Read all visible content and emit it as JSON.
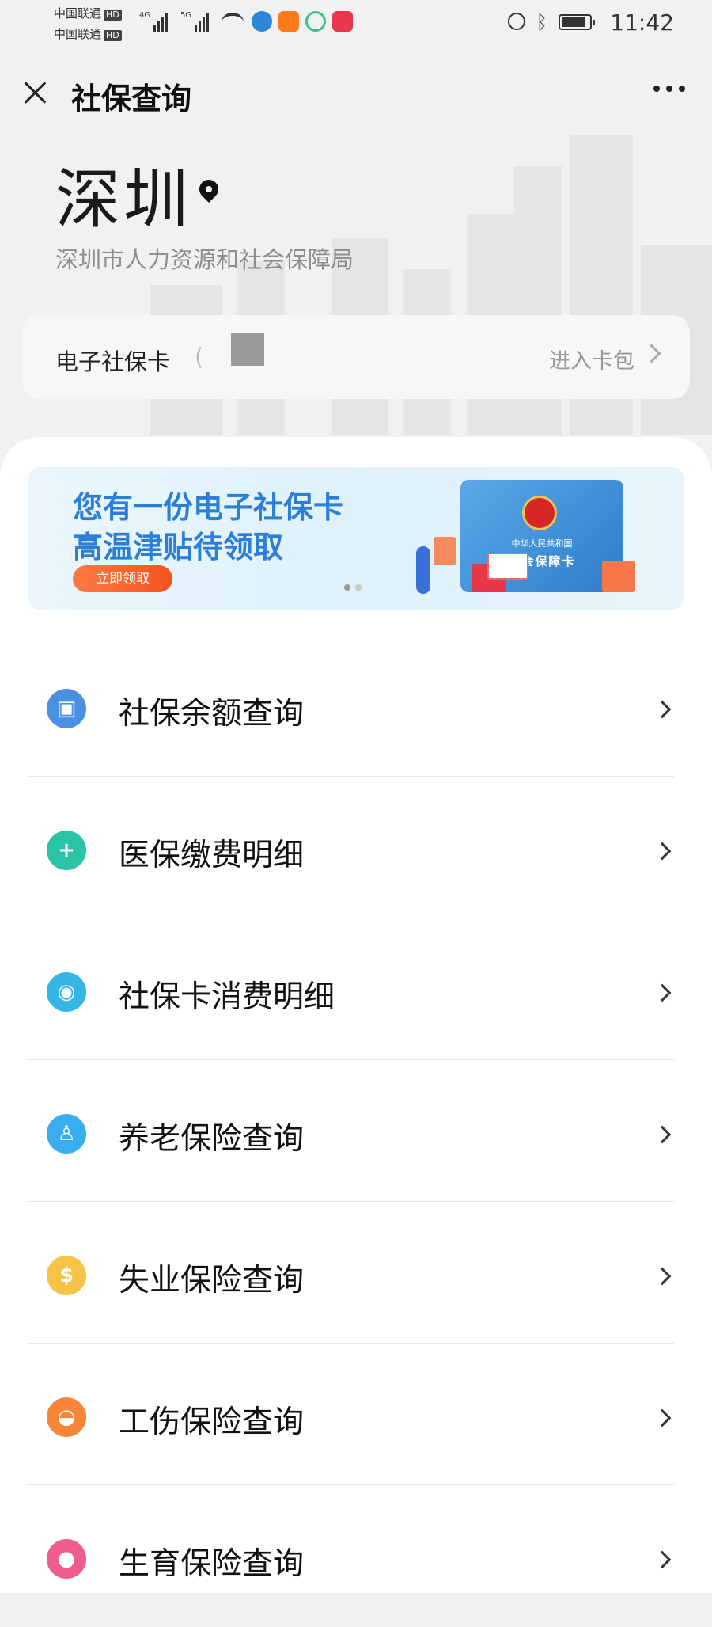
{
  "status_bar": {
    "carrier_1": "中国联通",
    "carrier_2": "中国联通",
    "hd": "HD",
    "net_1": "4G",
    "net_2": "5G",
    "time": "11:42"
  },
  "header": {
    "title": "社保查询",
    "close_icon": "close-icon",
    "more_icon": "more-icon"
  },
  "location": {
    "city": "深圳",
    "bureau": "深圳市人力资源和社会保障局"
  },
  "card_bar": {
    "label": "电子社保卡",
    "paren": "(",
    "action": "进入卡包"
  },
  "banner": {
    "line1": "您有一份电子社保卡",
    "line2": "高温津贴待领取",
    "button": "立即领取",
    "card_country": "中华人民共和国",
    "card_name": "社会保障卡"
  },
  "menu": [
    {
      "label": "社保余额查询",
      "icon": "id-card-icon",
      "color": "#4a90e2"
    },
    {
      "label": "医保缴费明细",
      "icon": "plus-icon",
      "color": "#2bc3a5"
    },
    {
      "label": "社保卡消费明细",
      "icon": "card-search-icon",
      "color": "#33b5e5"
    },
    {
      "label": "养老保险查询",
      "icon": "elder-icon",
      "color": "#38aef0"
    },
    {
      "label": "失业保险查询",
      "icon": "dollar-icon",
      "color": "#f5c345"
    },
    {
      "label": "工伤保险查询",
      "icon": "helmet-icon",
      "color": "#f7863a"
    },
    {
      "label": "生育保险查询",
      "icon": "baby-icon",
      "color": "#ee5d8b"
    }
  ]
}
